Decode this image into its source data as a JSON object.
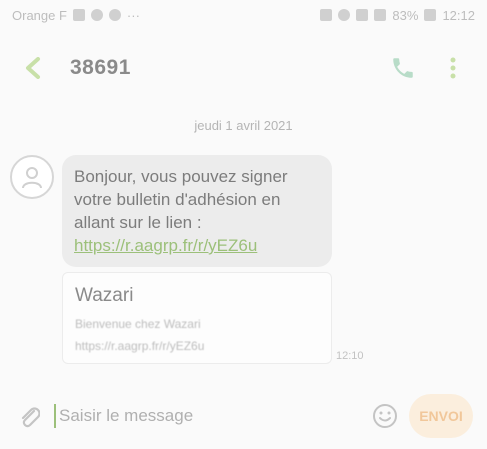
{
  "status_bar": {
    "carrier": "Orange F",
    "dots": "···",
    "battery": "83%",
    "time": "12:12"
  },
  "header": {
    "contact": "38691",
    "accent": "#c8e0a8"
  },
  "conversation": {
    "date": "jeudi 1 avril 2021",
    "message": {
      "text": "Bonjour, vous pouvez signer votre bulletin d'adhésion en allant sur le lien :",
      "link": "https://r.aagrp.fr/r/yEZ6u",
      "time": "12:10"
    },
    "preview": {
      "title": "Wazari",
      "subtitle": "Bienvenue chez Wazari",
      "url": "https://r.aagrp.fr/r/yEZ6u"
    }
  },
  "compose": {
    "placeholder": "Saisir le message",
    "send_label": "ENVOI"
  },
  "colors": {
    "link": "#9cc07a",
    "send_bg": "#fbeedd",
    "send_text": "#f1c79a"
  }
}
